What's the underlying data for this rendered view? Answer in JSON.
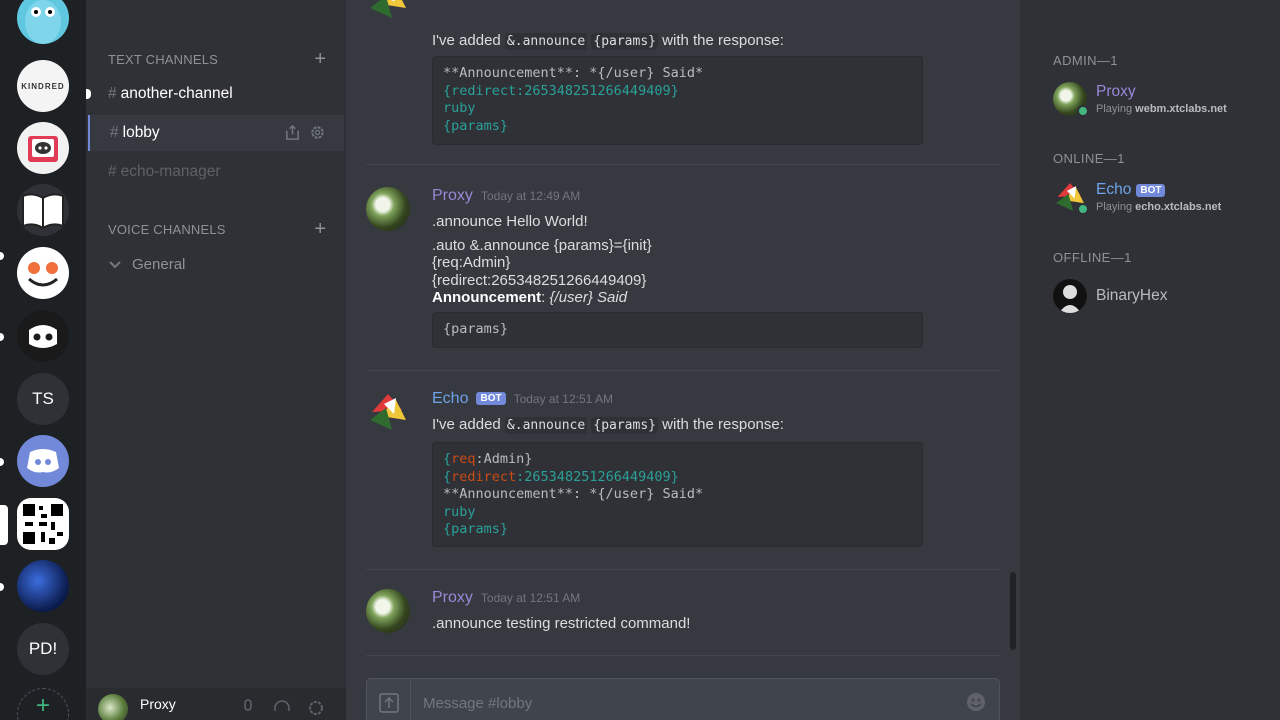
{
  "servers": [
    {
      "name": "gopher-server-icon"
    },
    {
      "name": "kindred-server-icon",
      "label": "KINDRED"
    },
    {
      "name": "discord-book-server-icon"
    },
    {
      "name": "open-book-server-icon"
    },
    {
      "name": "smiley-server-icon"
    },
    {
      "name": "robot-server-icon"
    },
    {
      "name": "ts-server",
      "label": "TS"
    },
    {
      "name": "discord-server-icon"
    },
    {
      "name": "qr-server-icon"
    },
    {
      "name": "night-server-icon"
    },
    {
      "name": "pd-server",
      "label": "PD!"
    }
  ],
  "sidebar": {
    "text_category": "TEXT CHANNELS",
    "voice_category": "VOICE CHANNELS",
    "text_channels": [
      {
        "hash": "#",
        "label": "another-channel"
      },
      {
        "hash": "#",
        "label": "lobby"
      },
      {
        "hash": "#",
        "label": "echo-manager"
      }
    ],
    "voice_channels": [
      {
        "label": "General"
      }
    ],
    "add_symbol": "+",
    "user": {
      "name": "Proxy"
    }
  },
  "chat": {
    "messages": [
      {
        "body_prefix": "I've added ",
        "code1": "&.announce",
        "code2": "{params}",
        "body_suffix": " with the response:",
        "codeblock": [
          "**Announcement**: *{/user} Said*",
          "{redirect:265348251266449409}",
          "ruby",
          "{params}"
        ]
      },
      {
        "author": "Proxy",
        "timestamp": "Today at 12:49 AM",
        "lines": [
          ".announce Hello World!",
          ".auto &.announce {params}={init}",
          "{req:Admin}",
          "{redirect:265348251266449409}"
        ],
        "bold_label": "Announcement",
        "italic_rest": "{/user} Said",
        "colon": ": ",
        "codeblock": [
          "{params}"
        ]
      },
      {
        "author": "Echo",
        "badge": "BOT",
        "timestamp": "Today at 12:51 AM",
        "body_prefix": "I've added ",
        "code1": "&.announce",
        "code2": "{params}",
        "body_suffix": " with the response:",
        "codeblock_parts": {
          "l1_open": "{",
          "l1_key": "req",
          "l1_rest": ":Admin}",
          "l2_open": "{",
          "l2_key": "redirect",
          "l2_rest": ":265348251266449409}",
          "l3": "**Announcement**: *{/user} Said*",
          "l4": "ruby",
          "l5": "{params}"
        }
      },
      {
        "author": "Proxy",
        "timestamp": "Today at 12:51 AM",
        "text": ".announce testing restricted command!"
      }
    ],
    "composer_placeholder": "Message #lobby"
  },
  "members": {
    "groups": [
      {
        "title": "ADMIN—1",
        "name": "Proxy",
        "playing_prefix": "Playing ",
        "playing_game": "webm.xtclabs.net",
        "color": "#9a88d9"
      },
      {
        "title": "ONLINE—1",
        "name": "Echo",
        "badge": "BOT",
        "playing_prefix": "Playing ",
        "playing_game": "echo.xtclabs.net",
        "color": "#6ea3e8"
      },
      {
        "title": "OFFLINE—1",
        "name": "BinaryHex"
      }
    ]
  },
  "colors": {
    "accent": "#7289da",
    "online": "#43b581",
    "proxy": "#9a88d9",
    "echo": "#6ea3e8"
  }
}
